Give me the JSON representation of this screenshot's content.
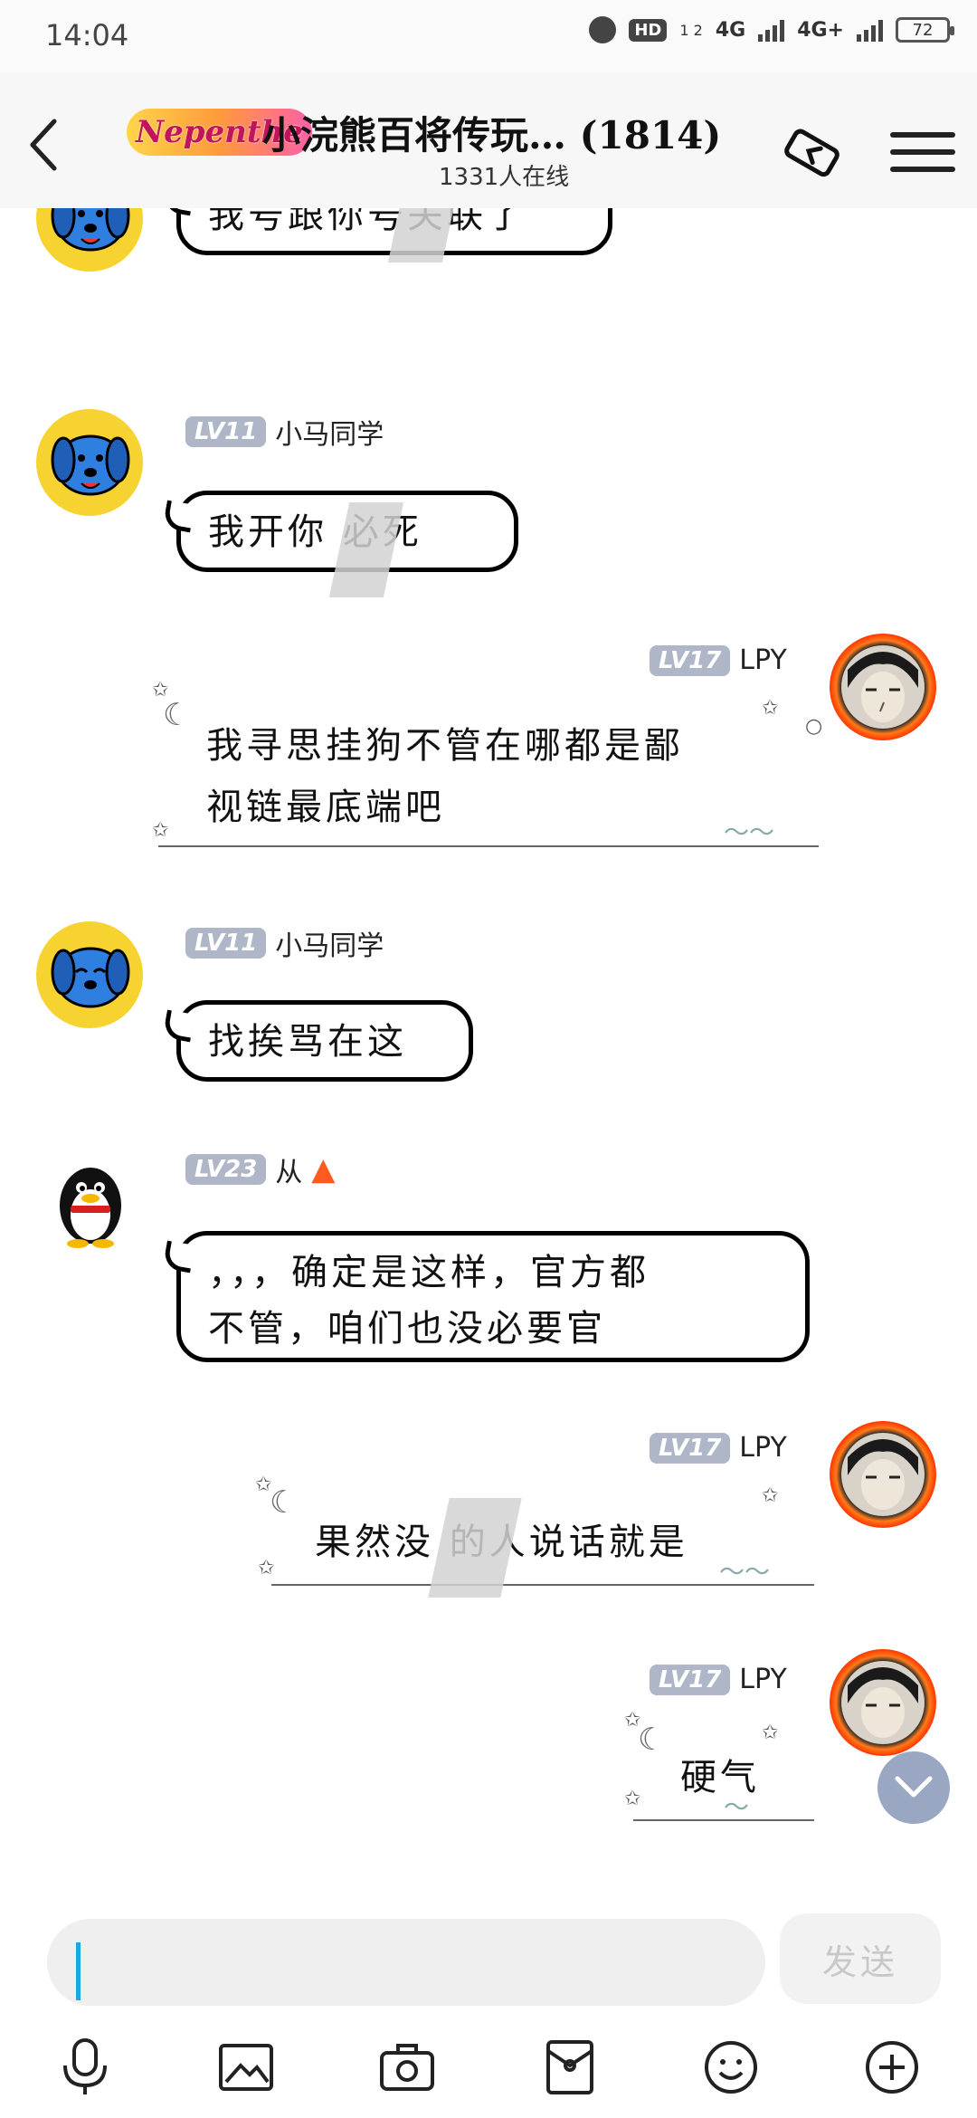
{
  "status_bar": {
    "time": "14:04",
    "hd": "HD",
    "sim_sub": "1 2",
    "net1": "4G",
    "net2": "4G+",
    "battery": "72"
  },
  "header": {
    "brand_logo_text": "Nepenthe",
    "title": "小浣熊百将传玩… (1814)",
    "online": "1331人在线"
  },
  "messages": [
    {
      "sender": "",
      "level": "",
      "side": "left",
      "avatar": "dog",
      "text": "我号跟你号关联了"
    },
    {
      "sender": "小马同学",
      "level": "LV11",
      "side": "left",
      "avatar": "dog",
      "text": "我开你 必死"
    },
    {
      "sender": "LPY",
      "level": "LV17",
      "side": "right",
      "avatar": "lpy",
      "text_line1": "我寻思挂狗不管在哪都是鄙",
      "text_line2": "视链最底端吧"
    },
    {
      "sender": "小马同学",
      "level": "LV11",
      "side": "left",
      "avatar": "dog",
      "text": "找挨骂在这"
    },
    {
      "sender": "从",
      "level": "LV23",
      "side": "left",
      "avatar": "penguin",
      "text_line1": "，，，确定是这样，官方都",
      "text_line2": "不管，咱们也没必要官"
    },
    {
      "sender": "LPY",
      "level": "LV17",
      "side": "right",
      "avatar": "lpy",
      "text": "果然没 的人说话就是"
    },
    {
      "sender": "LPY",
      "level": "LV17",
      "side": "right",
      "avatar": "lpy",
      "text": "硬气"
    }
  ],
  "input": {
    "value": "",
    "send_label": "发送"
  },
  "colors": {
    "level_badge": "#aeb6c8",
    "cursor": "#1aa7e8",
    "scroll_button": "#9aa7c2"
  },
  "toolbar_icons": [
    "microphone-icon",
    "image-icon",
    "camera-icon",
    "red-packet-icon",
    "emoji-icon",
    "plus-icon"
  ]
}
